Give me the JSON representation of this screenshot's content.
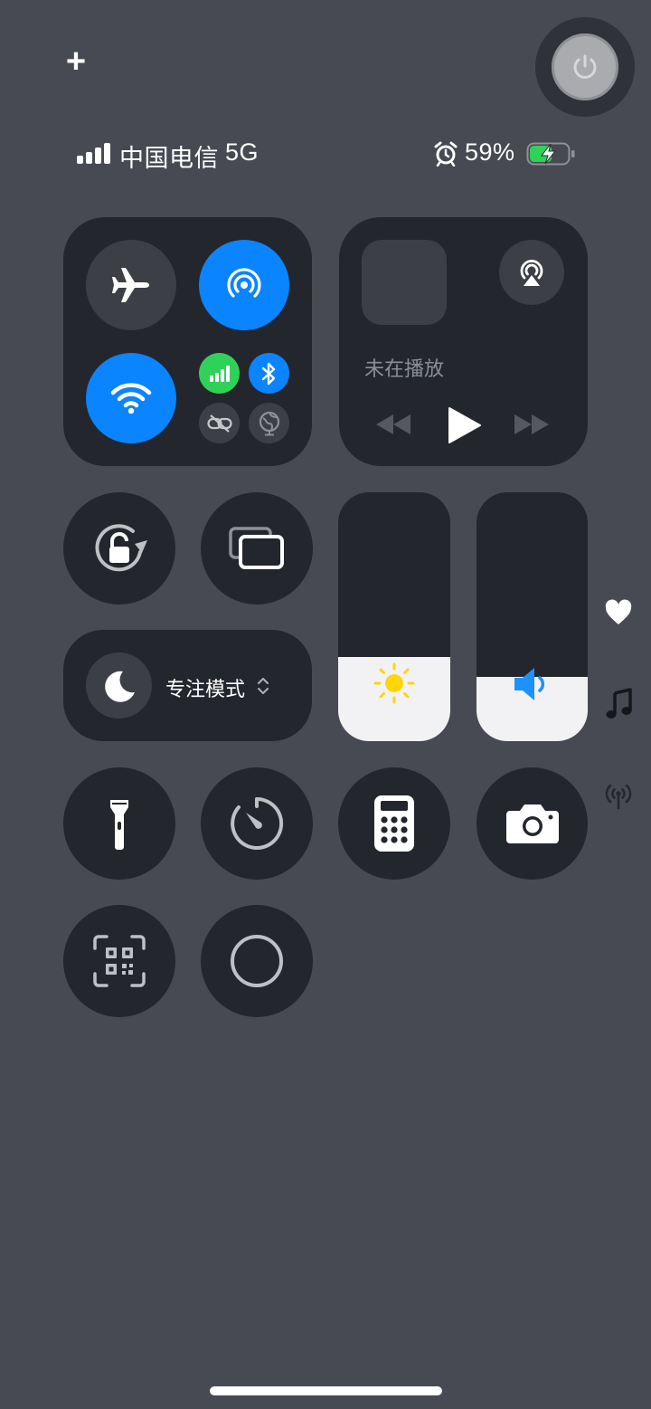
{
  "status_bar": {
    "carrier": "中国电信",
    "network": "5G",
    "battery_percent": "59%",
    "battery_level": 0.59,
    "charging": true,
    "signal_bars": 4,
    "alarm": true
  },
  "top": {
    "add_label": "+",
    "power_icon": "power-icon"
  },
  "connectivity": {
    "airplane_mode": false,
    "airdrop": true,
    "wifi": true,
    "cellular_data": true,
    "bluetooth": true,
    "vpn_link": false,
    "satellite": false
  },
  "now_playing": {
    "status": "未在播放",
    "airplay_icon": "airplay-icon"
  },
  "focus": {
    "label": "专注模式"
  },
  "sliders": {
    "brightness": 0.34,
    "volume": 0.26
  },
  "side_icons": [
    "heart-icon",
    "music-note-icon",
    "broadcast-icon"
  ],
  "colors": {
    "background": "#474a52",
    "tile": "#23262d",
    "accent_blue": "#0a84ff",
    "cellular_green": "#30d158",
    "brightness_yellow": "#ffd60a",
    "volume_blue": "#1e90ff"
  }
}
